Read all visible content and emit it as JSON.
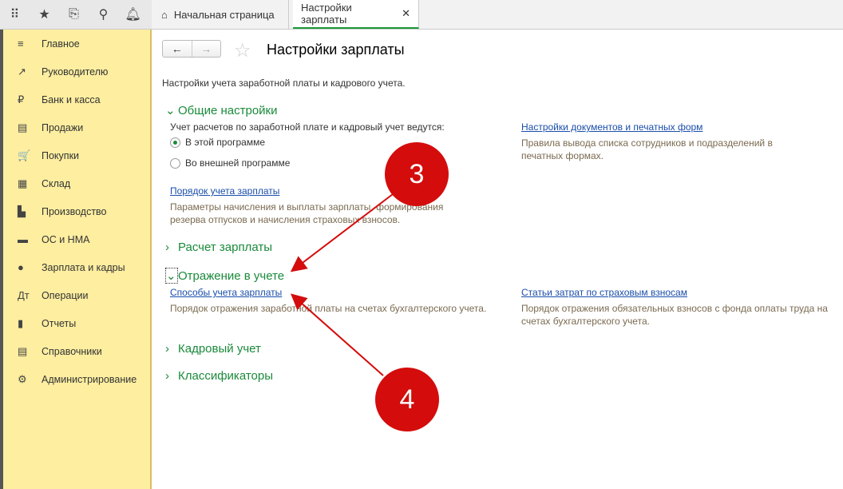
{
  "topbar": {
    "icons": [
      "apps-icon",
      "star-icon",
      "history-icon",
      "search-icon",
      "bell-icon"
    ],
    "tabs": [
      {
        "label": "Начальная страница"
      },
      {
        "label": "Настройки зарплаты"
      }
    ]
  },
  "sidebar": {
    "items": [
      {
        "label": "Главное",
        "icon": "≡"
      },
      {
        "label": "Руководителю",
        "icon": "↗"
      },
      {
        "label": "Банк и касса",
        "icon": "₽"
      },
      {
        "label": "Продажи",
        "icon": "▤"
      },
      {
        "label": "Покупки",
        "icon": "🛒"
      },
      {
        "label": "Склад",
        "icon": "▦"
      },
      {
        "label": "Производство",
        "icon": "▙"
      },
      {
        "label": "ОС и НМА",
        "icon": "▬"
      },
      {
        "label": "Зарплата и кадры",
        "icon": "●"
      },
      {
        "label": "Операции",
        "icon": "Дт"
      },
      {
        "label": "Отчеты",
        "icon": "▮"
      },
      {
        "label": "Справочники",
        "icon": "▤"
      },
      {
        "label": "Администрирование",
        "icon": "⚙"
      }
    ]
  },
  "page": {
    "title": "Настройки зарплаты",
    "description": "Настройки учета заработной платы и кадрового учета.",
    "general": {
      "title": "Общие настройки",
      "question": "Учет расчетов по заработной плате и кадровый учет ведутся:",
      "options": [
        "В этой программе",
        "Во внешней программе"
      ],
      "selected": 0,
      "link1": "Порядок учета зарплаты",
      "note1": "Параметры начисления и выплаты зарплаты, формирования резерва отпусков и начисления страховых взносов.",
      "link2": "Настройки документов и печатных форм",
      "note2": "Правила вывода списка сотрудников и подразделений в печатных формах."
    },
    "payroll": "Расчет зарплаты",
    "accounting": {
      "title": "Отражение в учете",
      "link1": "Способы учета зарплаты",
      "note1": "Порядок отражения заработной платы на счетах бухгалтерского учета.",
      "link2": "Статьи затрат по страховым взносам",
      "note2": "Порядок отражения обязательных взносов с фонда оплаты труда на счетах бухгалтерского учета."
    },
    "hr": "Кадровый учет",
    "classifiers": "Классификаторы"
  },
  "annotations": {
    "badge3": "3",
    "badge4": "4",
    "color": "#d40c0c"
  }
}
